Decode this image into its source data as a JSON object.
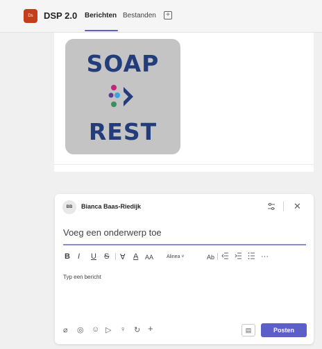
{
  "header": {
    "team_initials": "Ds",
    "team_name": "DSP 2.0",
    "tabs": [
      {
        "label": "Berichten",
        "active": true
      },
      {
        "label": "Bestanden",
        "active": false
      }
    ],
    "add_tab_symbol": "+"
  },
  "post": {
    "image": {
      "top_text": "SOAP",
      "bottom_text": "REST"
    }
  },
  "composer": {
    "author_initials": "BB",
    "author_name": "Bianca Baas-Riedijk",
    "subject_placeholder": "Voeg een onderwerp toe",
    "toolbar": {
      "bold": "B",
      "italic": "I",
      "underline": "U",
      "strike": "S",
      "highlight": "∀",
      "font_color": "A",
      "font_size": "AA",
      "paragraph": "Alinea ˅",
      "style": "Ab",
      "more": "···"
    },
    "body_placeholder": "Typ een bericht",
    "post_button": "Posten"
  },
  "colors": {
    "accent": "#5b5fc7",
    "team_badge": "#c43e1c",
    "logo_text": "#233d7a"
  }
}
